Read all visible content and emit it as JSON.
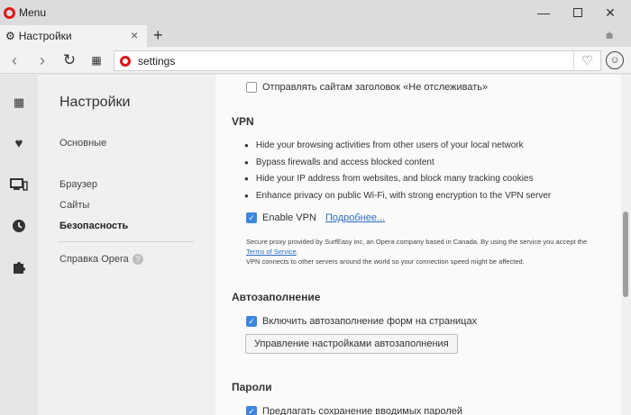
{
  "window": {
    "menu_label": "Menu",
    "minimize": "—",
    "close": "✕"
  },
  "tabs": [
    {
      "title": "Настройки",
      "icon": "gear-icon",
      "active": true
    }
  ],
  "tab_controls": {
    "close": "×",
    "new_tab": "+",
    "tab_menu": "⩧"
  },
  "addressbar": {
    "back": "‹",
    "forward": "›",
    "reload": "↻",
    "speed_dial": "▦",
    "url": "settings",
    "bookmark_icon": "heart-icon",
    "profile_icon": "profile-icon"
  },
  "sidebar_icons": [
    "speed-dial-icon",
    "heart-icon",
    "devices-icon",
    "history-icon",
    "extensions-icon"
  ],
  "settings_nav": {
    "title": "Настройки",
    "items": [
      {
        "label": "Основные",
        "active": false
      },
      {
        "label": "Браузер",
        "active": false
      },
      {
        "label": "Сайты",
        "active": false
      },
      {
        "label": "Безопасность",
        "active": true
      }
    ],
    "help_label": "Справка Opera",
    "help_icon": "?"
  },
  "content": {
    "do_not_track": {
      "label": "Отправлять сайтам заголовок «Не отслеживать»",
      "checked": false
    },
    "vpn": {
      "title": "VPN",
      "bullets": [
        "Hide your browsing activities from other users of your local network",
        "Bypass firewalls and access blocked content",
        "Hide your IP address from websites, and block many tracking cookies",
        "Enhance privacy on public Wi-Fi, with strong encryption to the VPN server"
      ],
      "enable_label": "Enable VPN",
      "enable_checked": true,
      "more_link": "Подробнее...",
      "fine_print_1": "Secure proxy provided by SurfEasy inc, an Opera company based in Canada. By using the service you accept the",
      "terms_link": "Terms of Service",
      "fine_print_2": "VPN connects to other servers around the world so your connection speed might be affected."
    },
    "autofill": {
      "title": "Автозаполнение",
      "enable_label": "Включить автозаполнение форм на страницах",
      "enable_checked": true,
      "manage_button": "Управление настройками автозаполнения"
    },
    "passwords": {
      "title": "Пароли",
      "offer_label": "Предлагать сохранение вводимых паролей",
      "offer_checked": true
    }
  },
  "colors": {
    "opera_red": "#e0161d",
    "checkbox_blue": "#3c86e0",
    "link_blue": "#2b6cc4"
  }
}
